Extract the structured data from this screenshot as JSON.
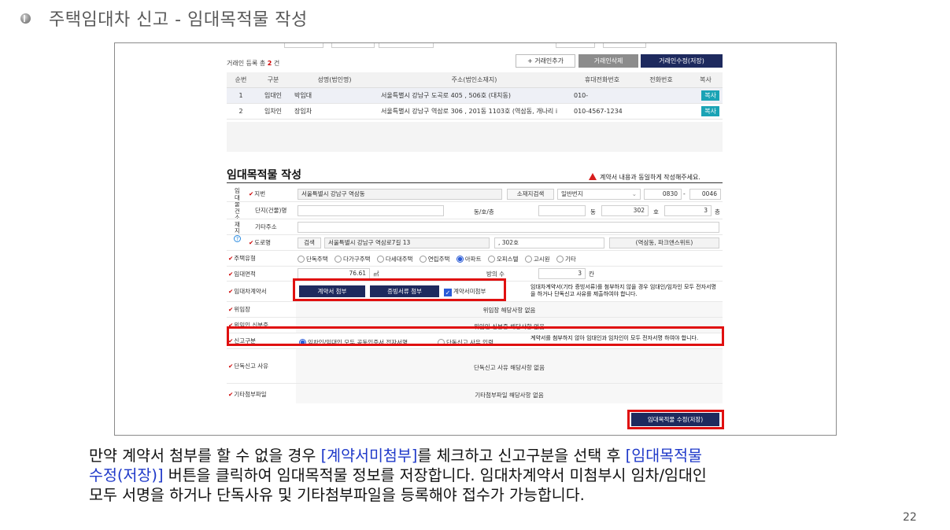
{
  "slide": {
    "title": "주택임대차 신고 - 임대목적물 작성",
    "page_number": "22"
  },
  "parties": {
    "count_prefix": "거래인 등록 총 ",
    "count_value": "2",
    "count_suffix": " 건",
    "add_button": "+ 거래인추가",
    "delete_button": "거래인삭제",
    "save_button": "거래인수정(저장)",
    "columns": [
      "순번",
      "구분",
      "성명(법인명)",
      "주소(법인소재지)",
      "휴대전화번호",
      "전화번호",
      "복사"
    ],
    "rows": [
      {
        "no": "1",
        "type": "임대인",
        "name": "박임대",
        "address": "서울특별시 강남구 도곡로 405 , 506호 (대치동)",
        "mobile": "010-",
        "phone": "",
        "copy": "복사"
      },
      {
        "no": "2",
        "type": "임차인",
        "name": "장임차",
        "address": "서울특별시 강남구 역삼로 306 , 201동 1103호 (역삼동, 개나리 i",
        "mobile": "010-4567-1234",
        "phone": "",
        "copy": "복사"
      }
    ]
  },
  "property": {
    "section_title": "임대목적물 작성",
    "warning": "계약서 내용과 동일하게 작성해주세요.",
    "location_vertical": [
      "임",
      "대",
      "물",
      "건",
      "소",
      "재",
      "지"
    ],
    "help_icon": "?",
    "lot_label": "지번",
    "lot_value": "서울특별시 강남구 역삼동",
    "location_search_button": "소재지검색",
    "lot_type": "일반번지",
    "lot_main": "0830",
    "lot_dash": "-",
    "lot_sub": "0046",
    "complex_label": "단지(건물)명",
    "dong_ho_label": "동/호/층",
    "dong_unit": "동",
    "ho_value": "302",
    "ho_unit": "호",
    "floor_value": "3",
    "floor_unit": "층",
    "other_address_label": "기타주소",
    "road_label": "도로명",
    "road_search": "검색",
    "road_value": "서울특별시 강남구 역삼로7길 13",
    "road_detail": ", 302호",
    "road_extra": "(역삼동, 파크앤스위트)",
    "housing_type_label": "주택유형",
    "housing_types": [
      "단독주택",
      "다가구주택",
      "다세대주택",
      "연립주택",
      "아파트",
      "오피스텔",
      "고시원",
      "기타"
    ],
    "housing_selected": "아파트",
    "area_label": "임대면적",
    "area_value": "76.61",
    "area_unit": "㎡",
    "rooms_label": "방의 수",
    "rooms_value": "3",
    "rooms_unit": "칸",
    "contract_label": "임대차계약서",
    "attach_contract_button": "계약서 첨부",
    "attach_proof_button": "증빙서류 첨부",
    "no_contract_checkbox": "계약서미첨부",
    "contract_note": "임대차계약서(기타 증빙서류)를 첨부하지 않을 경우 임대인/임차인 모두 전자서명을 하거나 단독신고 사유를 제출하여야 합니다.",
    "delegation_label": "위임장",
    "delegation_value": "위임장 해당사항 없음",
    "delegate_id_label": "위임인 신분증",
    "delegate_id_value": "위임인 신분증 해당사항 없음",
    "report_type_label": "신고구분",
    "report_option_1": "임차인/임대인 모두 공동인증서 전자서명",
    "report_option_2": "단독신고 사유 입력",
    "report_note": "계약서를 첨부하지 않아 임대인과 임차인이 모두 전자서명 하여야 합니다.",
    "solo_reason_label": "단독신고 사유",
    "solo_reason_value": "단독신고 사유 해당사항 없음",
    "other_files_label": "기타첨부파일",
    "other_files_value": "기타첨부파일 해당사항 없음",
    "save_property_button": "임대목적물 수정(저장)"
  },
  "caption": {
    "line1_a": "만약 계약서 첨부를 할 수 없을 경우 ",
    "line1_hl": "[계약서미첨부]",
    "line1_b": "를 체크하고 신고구분을 선택 후 ",
    "line1_hl2": "[임대목적물",
    "line2_hl": "수정(저장)]",
    "line2_b": " 버튼을 클릭하여 임대목적물 정보를 저장합니다. 임대차계약서 미첨부시 임차/임대인",
    "line3": "모두 서명을 하거나 단독사유 및 기타첨부파일을 등록해야 접수가 가능합니다."
  },
  "colors": {
    "accent": "#1e2a5e",
    "highlight_box": "#e01010",
    "link": "#1f39c9",
    "copy_button": "#1aa3b5"
  }
}
